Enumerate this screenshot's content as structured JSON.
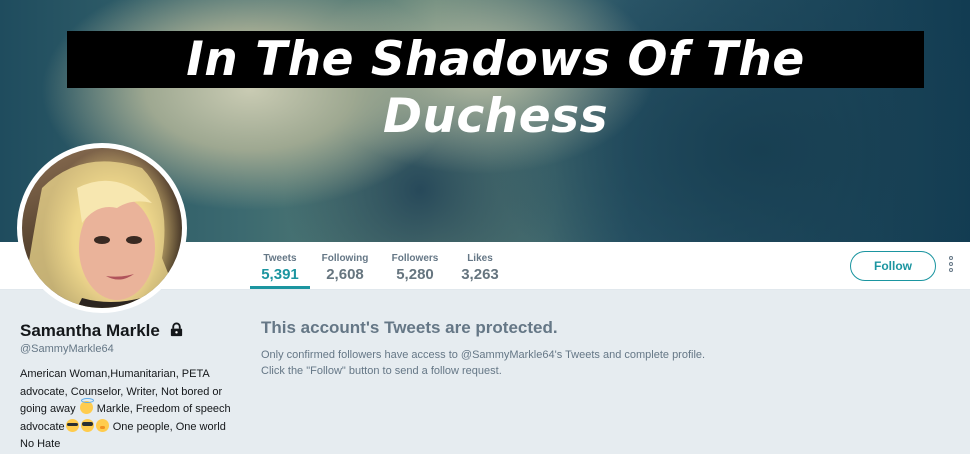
{
  "banner": {
    "title": "In The Shadows Of The Duchess"
  },
  "nav": {
    "items": [
      {
        "label": "Tweets",
        "value": "5,391",
        "active": true
      },
      {
        "label": "Following",
        "value": "2,608"
      },
      {
        "label": "Followers",
        "value": "5,280"
      },
      {
        "label": "Likes",
        "value": "3,263"
      }
    ],
    "follow_label": "Follow"
  },
  "profile": {
    "name": "Samantha Markle",
    "handle": "@SammyMarkle64",
    "bio_parts": [
      "American Woman,Humanitarian, PETA advocate, Counselor, Writer, Not bored or going away",
      "Markle, Freedom of speech advocate",
      "One people, One world No Hate"
    ]
  },
  "protected": {
    "title": "This account's Tweets are protected.",
    "line1": "Only confirmed followers have access to @SammyMarkle64's Tweets and complete profile.",
    "line2": "Click the \"Follow\" button to send a follow request."
  },
  "colors": {
    "accent": "#1b95a0",
    "muted": "#657786",
    "background": "#e6ecf0"
  },
  "icons": [
    "lock-icon",
    "more-options-icon",
    "smiling-face-with-halo-icon",
    "nerd-face-icon",
    "smiling-face-with-sunglasses-icon",
    "hugging-face-icon"
  ]
}
